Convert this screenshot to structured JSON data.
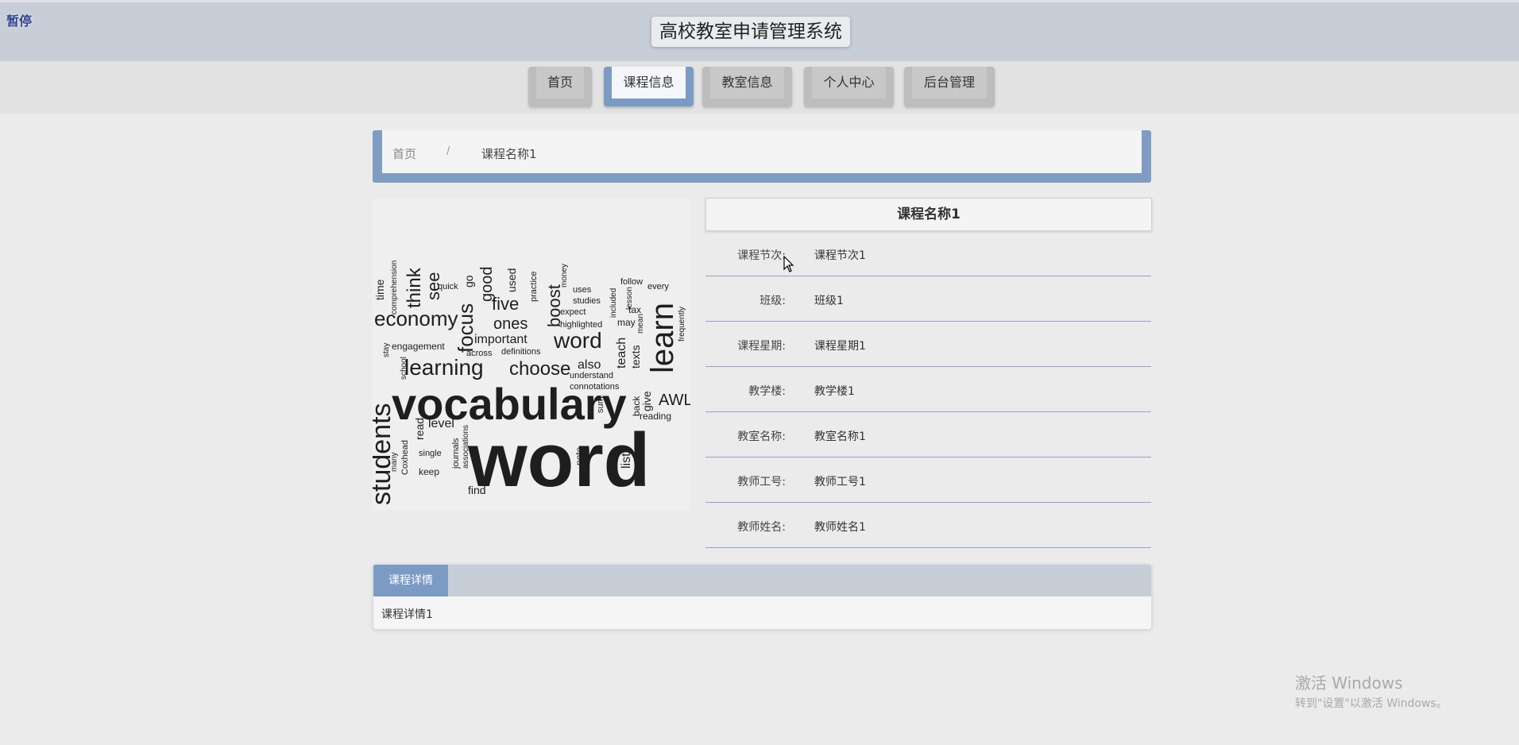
{
  "overlay": {
    "pause_label": "暂停"
  },
  "header": {
    "title": "高校教室申请管理系统"
  },
  "nav": {
    "items": [
      {
        "label": "首页"
      },
      {
        "label": "课程信息",
        "active": true
      },
      {
        "label": "教室信息"
      },
      {
        "label": "个人中心"
      },
      {
        "label": "后台管理"
      }
    ]
  },
  "breadcrumb": {
    "home": "首页",
    "separator": "/",
    "current": "课程名称1"
  },
  "detail": {
    "title": "课程名称1",
    "rows": [
      {
        "label": "课程节次:",
        "value": "课程节次1"
      },
      {
        "label": "班级:",
        "value": "班级1"
      },
      {
        "label": "课程星期:",
        "value": "课程星期1"
      },
      {
        "label": "教学楼:",
        "value": "教学楼1"
      },
      {
        "label": "教室名称:",
        "value": "教室名称1"
      },
      {
        "label": "教师工号:",
        "value": "教师工号1"
      },
      {
        "label": "教师姓名:",
        "value": "教师姓名1"
      }
    ]
  },
  "image": {
    "words": [
      "vocabulary",
      "word",
      "learning",
      "learn",
      "word",
      "choose",
      "focus",
      "students",
      "economy",
      "think",
      "see",
      "five",
      "ones",
      "boost",
      "good",
      "important",
      "teach",
      "texts",
      "level",
      "read",
      "keep",
      "find",
      "note",
      "list",
      "give",
      "back",
      "reading",
      "also",
      "definitions",
      "across",
      "engagement",
      "school",
      "single",
      "journals",
      "associations",
      "sum",
      "highlighted",
      "expect",
      "studies",
      "uses",
      "may",
      "tax",
      "follow",
      "every",
      "frequently",
      "quick",
      "go",
      "used",
      "practice",
      "money",
      "time",
      "comprehension",
      "understand",
      "connotations",
      "AWL",
      "mean",
      "lesson",
      "included",
      "stay",
      "many",
      "Coxhead"
    ]
  },
  "tabs": {
    "active_label": "课程详情",
    "content": "课程详情1"
  },
  "watermark": {
    "title": "激活 Windows",
    "subtitle": "转到\"设置\"以激活 Windows。"
  },
  "colors": {
    "accent": "#7b9bc4",
    "header_bg": "#c8ced8",
    "page_bg": "#ebebeb"
  }
}
